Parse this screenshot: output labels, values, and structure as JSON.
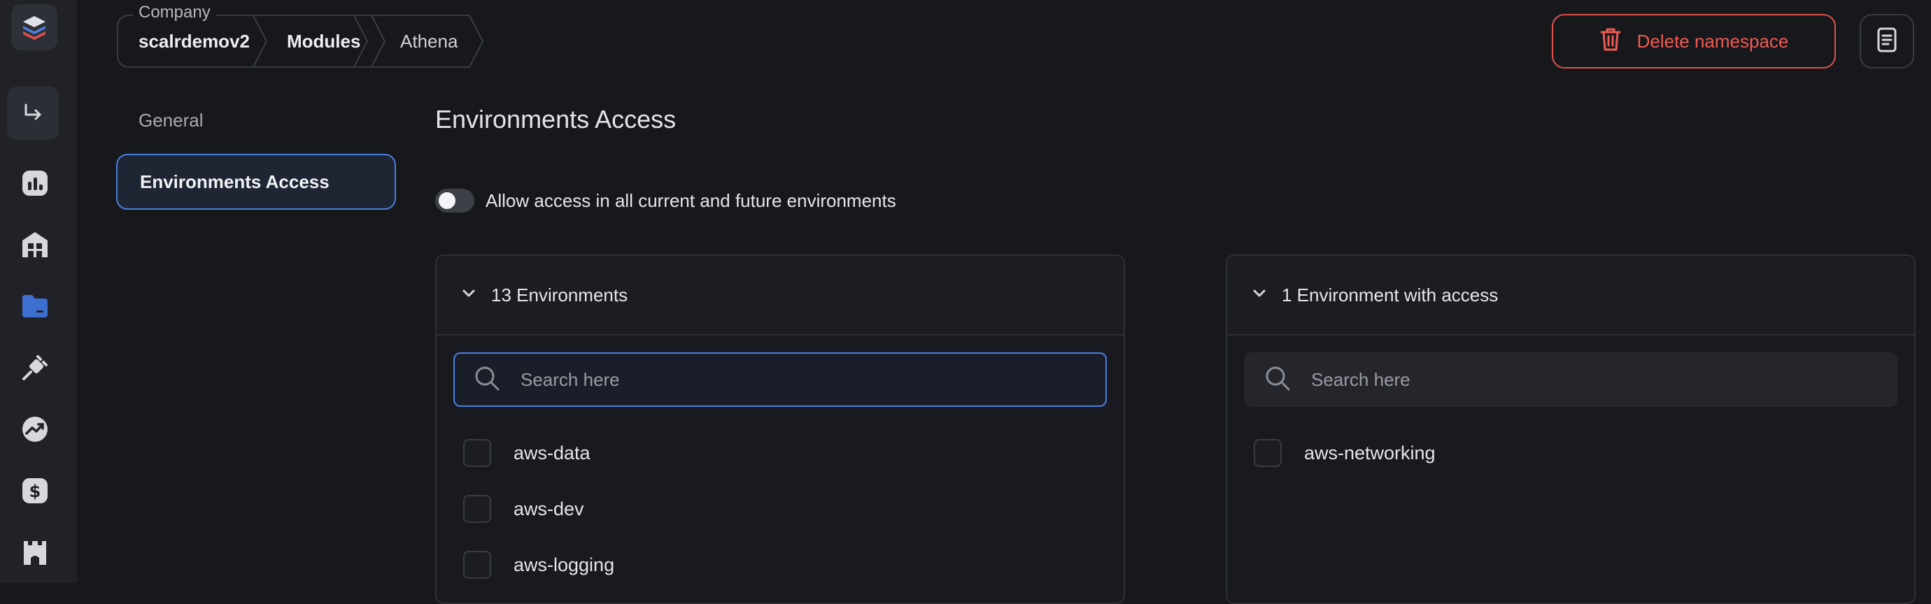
{
  "breadcrumb": {
    "legend": "Company",
    "items": [
      "scalrdemov2",
      "Modules",
      "Athena"
    ]
  },
  "actions": {
    "delete_label": "Delete namespace"
  },
  "menu": {
    "items": [
      "General",
      "Environments Access"
    ],
    "active": "Environments Access"
  },
  "page": {
    "title": "Environments Access"
  },
  "toggle": {
    "label": "Allow access in all current and future environments",
    "on": false
  },
  "available_panel": {
    "header": "13 Environments",
    "search_placeholder": "Search here",
    "items": [
      "aws-data",
      "aws-dev",
      "aws-logging"
    ]
  },
  "access_panel": {
    "header": "1 Environment with access",
    "search_placeholder": "Search here",
    "items": [
      "aws-networking"
    ]
  },
  "colors": {
    "accent": "#4a7fe0",
    "danger": "#f05b52",
    "background": "#17181c"
  },
  "icons": {
    "rail": [
      "logo-icon",
      "collapse-icon",
      "dashboard-icon",
      "building-icon",
      "folder-icon",
      "plug-icon",
      "trend-icon",
      "dollar-icon",
      "castle-icon"
    ],
    "actions": [
      "trash-icon",
      "document-icon"
    ]
  }
}
